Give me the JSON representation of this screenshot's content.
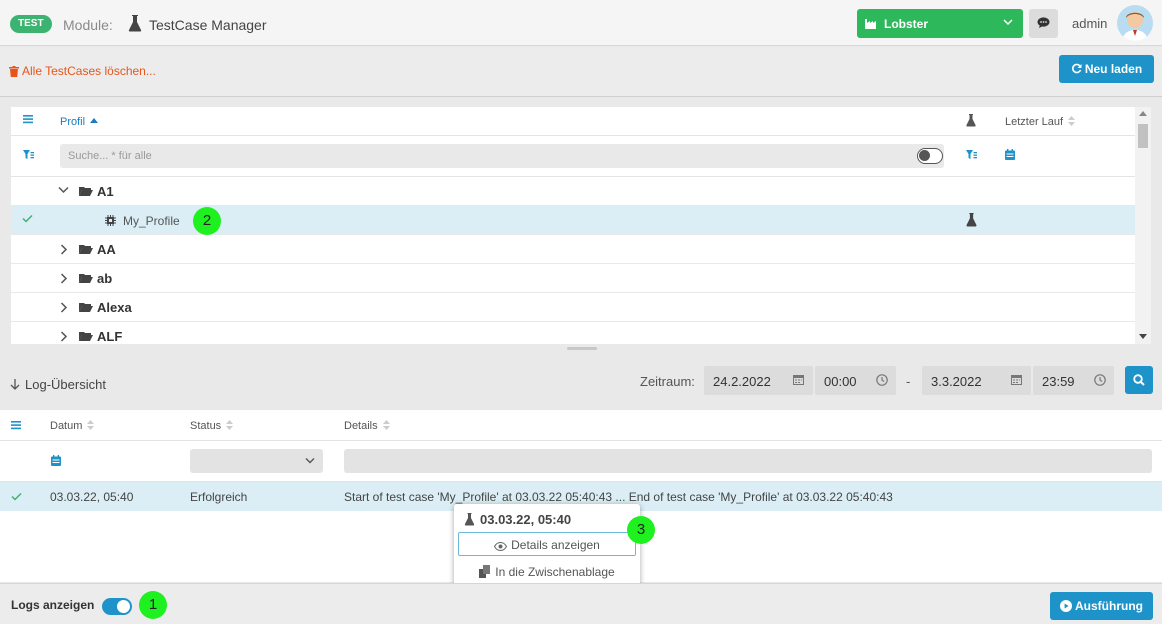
{
  "header": {
    "env_badge": "TEST",
    "module_label": "Module:",
    "module_name": "TestCase Manager",
    "client_name": "Lobster",
    "user_name": "admin"
  },
  "toolbar": {
    "delete_all": "Alle TestCases löschen...",
    "reload": "Neu laden"
  },
  "tree": {
    "col_profile": "Profil",
    "col_last_run": "Letzter Lauf",
    "search_placeholder": "Suche... * für alle",
    "rows": [
      {
        "label": "A1",
        "expanded": true
      },
      {
        "label": "My_Profile",
        "selected": true,
        "leaf": true
      },
      {
        "label": "AA"
      },
      {
        "label": "ab"
      },
      {
        "label": "Alexa"
      },
      {
        "label": "ALF"
      }
    ]
  },
  "log": {
    "title": "Log-Übersicht",
    "range_label": "Zeitraum:",
    "from_date": "24.2.2022",
    "from_time": "00:00",
    "range_dash": "-",
    "to_date": "3.3.2022",
    "to_time": "23:59",
    "columns": [
      "Datum",
      "Status",
      "Details"
    ],
    "rows": [
      {
        "date": "03.03.22, 05:40",
        "status": "Erfolgreich",
        "details": "Start of test case 'My_Profile' at 03.03.22 05:40:43 ... End of test case 'My_Profile' at 03.03.22 05:40:43"
      }
    ]
  },
  "context_menu": {
    "title": "03.03.22, 05:40",
    "items": [
      "Details anzeigen",
      "In die Zwischenablage"
    ]
  },
  "footer": {
    "logs_label": "Logs anzeigen",
    "logs_toggle_on": true,
    "execute": "Ausführung"
  },
  "markers": [
    "1",
    "2",
    "3"
  ],
  "colors": {
    "accent": "#1d93c9",
    "client_green": "#2eb85c",
    "danger": "#e8551b",
    "selected_row": "#dbeef5",
    "marker": "#1ff01f"
  }
}
